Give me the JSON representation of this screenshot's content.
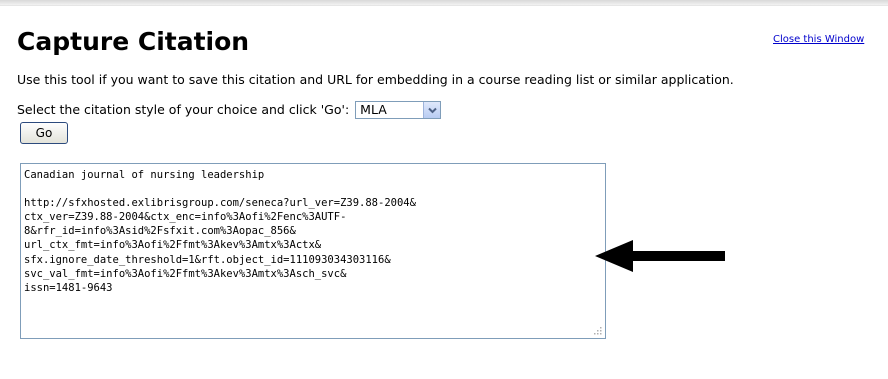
{
  "page": {
    "title": "Capture Citation",
    "close_link": "Close this Window",
    "intro": "Use this tool if you want to save this citation and URL for embedding in a course reading list or similar application.",
    "select_prompt": "Select the citation style of your choice and click 'Go':",
    "style_selected": "MLA",
    "go_label": "Go"
  },
  "citation": {
    "lines": [
      "Canadian journal of nursing leadership",
      "",
      "http://sfxhosted.exlibrisgroup.com/seneca?url_ver=Z39.88-2004&",
      "ctx_ver=Z39.88-2004&ctx_enc=info%3Aofi%2Fenc%3AUTF-",
      "8&rfr_id=info%3Asid%2Fsfxit.com%3Aopac_856&",
      "url_ctx_fmt=info%3Aofi%2Ffmt%3Akev%3Amtx%3Actx&",
      "sfx.ignore_date_threshold=1&rft.object_id=111093034303116&",
      "svc_val_fmt=info%3Aofi%2Ffmt%3Akev%3Amtx%3Asch_svc&",
      "issn=1481-9643"
    ]
  },
  "icons": {
    "dropdown": "chevron-down-icon",
    "arrow": "arrow-left-icon",
    "grip": "resize-grip-icon"
  },
  "colors": {
    "link": "#0000cc",
    "field_border": "#7f9db9",
    "button_border": "#2c4a7d",
    "arrow": "#000000"
  }
}
